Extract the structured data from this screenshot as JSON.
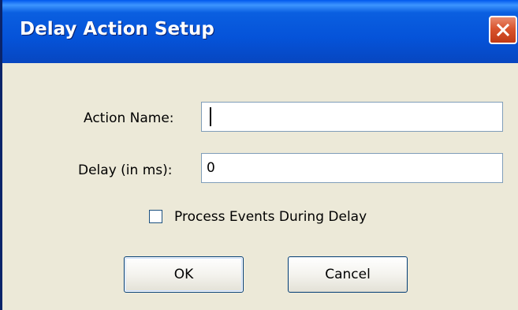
{
  "window": {
    "title": "Delay Action Setup"
  },
  "icons": {
    "close": "close-icon",
    "checkbox": "checkbox-unchecked"
  },
  "colors": {
    "titlebar": "#0553d9",
    "close_button": "#d9542e",
    "face": "#ece9d8"
  },
  "form": {
    "action_name_label": "Action Name:",
    "action_name_value": "",
    "delay_label": "Delay (in ms):",
    "delay_value": "0",
    "process_events_label": "Process Events During Delay",
    "process_events_checked": false
  },
  "buttons": {
    "ok": "OK",
    "cancel": "Cancel"
  }
}
